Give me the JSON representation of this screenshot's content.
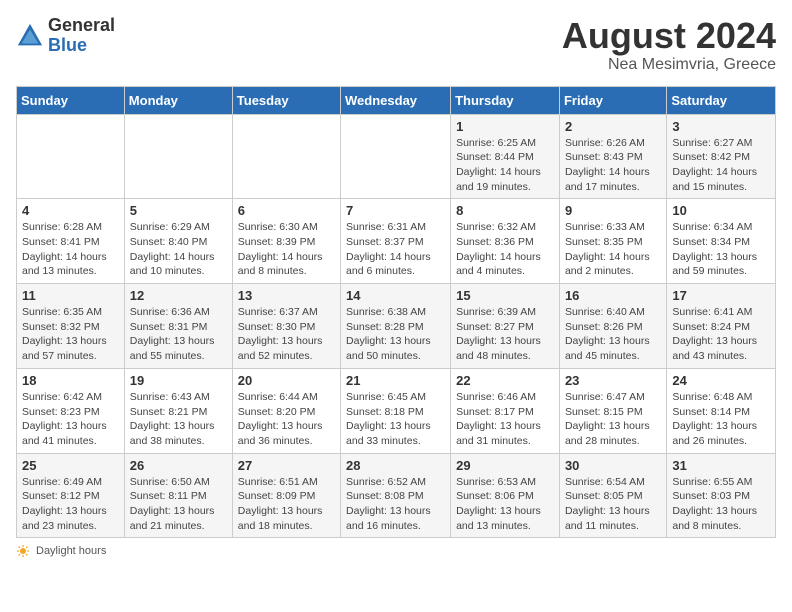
{
  "header": {
    "logo_general": "General",
    "logo_blue": "Blue",
    "month_title": "August 2024",
    "location": "Nea Mesimvria, Greece"
  },
  "days_of_week": [
    "Sunday",
    "Monday",
    "Tuesday",
    "Wednesday",
    "Thursday",
    "Friday",
    "Saturday"
  ],
  "weeks": [
    [
      {
        "day": "",
        "info": ""
      },
      {
        "day": "",
        "info": ""
      },
      {
        "day": "",
        "info": ""
      },
      {
        "day": "",
        "info": ""
      },
      {
        "day": "1",
        "info": "Sunrise: 6:25 AM\nSunset: 8:44 PM\nDaylight: 14 hours and 19 minutes."
      },
      {
        "day": "2",
        "info": "Sunrise: 6:26 AM\nSunset: 8:43 PM\nDaylight: 14 hours and 17 minutes."
      },
      {
        "day": "3",
        "info": "Sunrise: 6:27 AM\nSunset: 8:42 PM\nDaylight: 14 hours and 15 minutes."
      }
    ],
    [
      {
        "day": "4",
        "info": "Sunrise: 6:28 AM\nSunset: 8:41 PM\nDaylight: 14 hours and 13 minutes."
      },
      {
        "day": "5",
        "info": "Sunrise: 6:29 AM\nSunset: 8:40 PM\nDaylight: 14 hours and 10 minutes."
      },
      {
        "day": "6",
        "info": "Sunrise: 6:30 AM\nSunset: 8:39 PM\nDaylight: 14 hours and 8 minutes."
      },
      {
        "day": "7",
        "info": "Sunrise: 6:31 AM\nSunset: 8:37 PM\nDaylight: 14 hours and 6 minutes."
      },
      {
        "day": "8",
        "info": "Sunrise: 6:32 AM\nSunset: 8:36 PM\nDaylight: 14 hours and 4 minutes."
      },
      {
        "day": "9",
        "info": "Sunrise: 6:33 AM\nSunset: 8:35 PM\nDaylight: 14 hours and 2 minutes."
      },
      {
        "day": "10",
        "info": "Sunrise: 6:34 AM\nSunset: 8:34 PM\nDaylight: 13 hours and 59 minutes."
      }
    ],
    [
      {
        "day": "11",
        "info": "Sunrise: 6:35 AM\nSunset: 8:32 PM\nDaylight: 13 hours and 57 minutes."
      },
      {
        "day": "12",
        "info": "Sunrise: 6:36 AM\nSunset: 8:31 PM\nDaylight: 13 hours and 55 minutes."
      },
      {
        "day": "13",
        "info": "Sunrise: 6:37 AM\nSunset: 8:30 PM\nDaylight: 13 hours and 52 minutes."
      },
      {
        "day": "14",
        "info": "Sunrise: 6:38 AM\nSunset: 8:28 PM\nDaylight: 13 hours and 50 minutes."
      },
      {
        "day": "15",
        "info": "Sunrise: 6:39 AM\nSunset: 8:27 PM\nDaylight: 13 hours and 48 minutes."
      },
      {
        "day": "16",
        "info": "Sunrise: 6:40 AM\nSunset: 8:26 PM\nDaylight: 13 hours and 45 minutes."
      },
      {
        "day": "17",
        "info": "Sunrise: 6:41 AM\nSunset: 8:24 PM\nDaylight: 13 hours and 43 minutes."
      }
    ],
    [
      {
        "day": "18",
        "info": "Sunrise: 6:42 AM\nSunset: 8:23 PM\nDaylight: 13 hours and 41 minutes."
      },
      {
        "day": "19",
        "info": "Sunrise: 6:43 AM\nSunset: 8:21 PM\nDaylight: 13 hours and 38 minutes."
      },
      {
        "day": "20",
        "info": "Sunrise: 6:44 AM\nSunset: 8:20 PM\nDaylight: 13 hours and 36 minutes."
      },
      {
        "day": "21",
        "info": "Sunrise: 6:45 AM\nSunset: 8:18 PM\nDaylight: 13 hours and 33 minutes."
      },
      {
        "day": "22",
        "info": "Sunrise: 6:46 AM\nSunset: 8:17 PM\nDaylight: 13 hours and 31 minutes."
      },
      {
        "day": "23",
        "info": "Sunrise: 6:47 AM\nSunset: 8:15 PM\nDaylight: 13 hours and 28 minutes."
      },
      {
        "day": "24",
        "info": "Sunrise: 6:48 AM\nSunset: 8:14 PM\nDaylight: 13 hours and 26 minutes."
      }
    ],
    [
      {
        "day": "25",
        "info": "Sunrise: 6:49 AM\nSunset: 8:12 PM\nDaylight: 13 hours and 23 minutes."
      },
      {
        "day": "26",
        "info": "Sunrise: 6:50 AM\nSunset: 8:11 PM\nDaylight: 13 hours and 21 minutes."
      },
      {
        "day": "27",
        "info": "Sunrise: 6:51 AM\nSunset: 8:09 PM\nDaylight: 13 hours and 18 minutes."
      },
      {
        "day": "28",
        "info": "Sunrise: 6:52 AM\nSunset: 8:08 PM\nDaylight: 13 hours and 16 minutes."
      },
      {
        "day": "29",
        "info": "Sunrise: 6:53 AM\nSunset: 8:06 PM\nDaylight: 13 hours and 13 minutes."
      },
      {
        "day": "30",
        "info": "Sunrise: 6:54 AM\nSunset: 8:05 PM\nDaylight: 13 hours and 11 minutes."
      },
      {
        "day": "31",
        "info": "Sunrise: 6:55 AM\nSunset: 8:03 PM\nDaylight: 13 hours and 8 minutes."
      }
    ]
  ],
  "footer": {
    "note": "Daylight hours"
  }
}
